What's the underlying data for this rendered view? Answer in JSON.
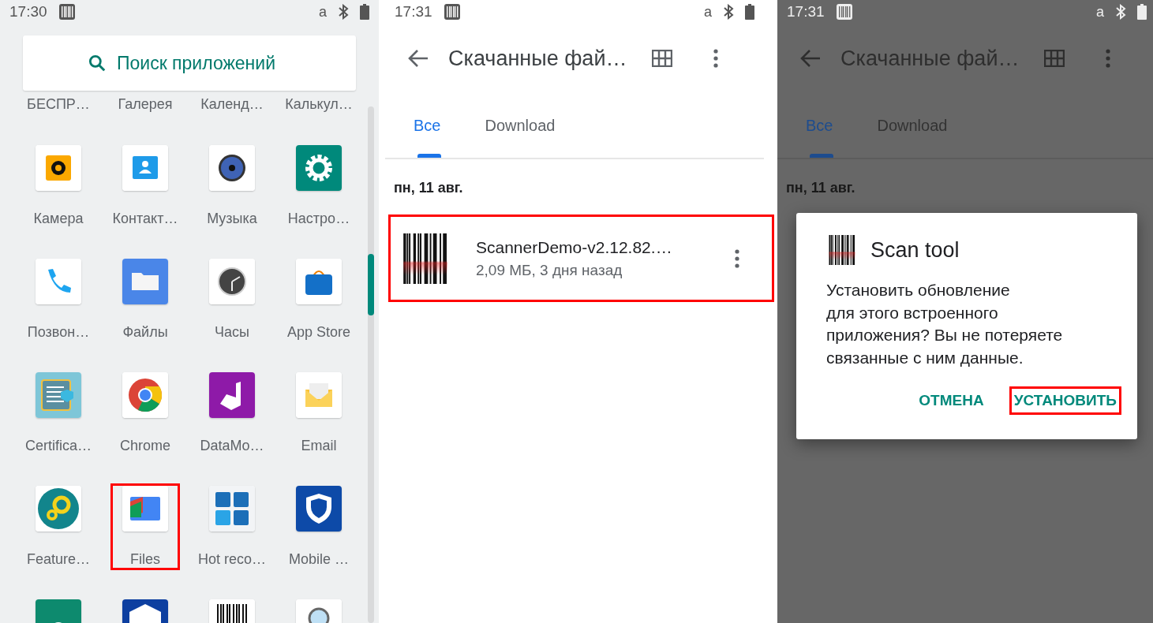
{
  "launcher": {
    "status_bar": {
      "time": "17:30",
      "keyboard": "a"
    },
    "search": {
      "placeholder": "Поиск приложений"
    },
    "app_rows": [
      {
        "apps": [
          {
            "label": "БЕСПР…"
          },
          {
            "label": "Галерея"
          },
          {
            "label": "Календ…"
          },
          {
            "label": "Калькул…"
          }
        ]
      },
      {
        "apps": [
          {
            "kind": "camera",
            "label": "Камера",
            "highlighted": false
          },
          {
            "kind": "contacts",
            "label": "Контакт…",
            "highlighted": false
          },
          {
            "kind": "speaker",
            "label": "Музыка",
            "highlighted": false
          },
          {
            "kind": "gear",
            "label": "Настро…",
            "highlighted": false
          }
        ]
      },
      {
        "apps": [
          {
            "kind": "phone",
            "label": "Позвон…",
            "highlighted": false
          },
          {
            "kind": "folder",
            "label": "Файлы",
            "highlighted": false
          },
          {
            "kind": "clock",
            "label": "Часы",
            "highlighted": false
          },
          {
            "kind": "bag",
            "label": "App Store",
            "highlighted": false
          }
        ]
      },
      {
        "apps": [
          {
            "kind": "certificate",
            "label": "Certifica…",
            "highlighted": false
          },
          {
            "kind": "chrome",
            "label": "Chrome",
            "highlighted": false
          },
          {
            "kind": "purple",
            "label": "DataMo…",
            "highlighted": false
          },
          {
            "kind": "envelope",
            "label": "Email",
            "highlighted": false
          }
        ]
      },
      {
        "apps": [
          {
            "kind": "gears",
            "label": "Feature…",
            "highlighted": false
          },
          {
            "kind": "files",
            "label": "Files",
            "highlighted": true
          },
          {
            "kind": "tiles",
            "label": "Hot reco…",
            "highlighted": false
          },
          {
            "kind": "shield",
            "label": "Mobile …",
            "highlighted": false
          }
        ]
      },
      {
        "apps": [
          {
            "kind": "android"
          },
          {
            "kind": "badge"
          },
          {
            "kind": "barcode"
          },
          {
            "kind": "magnifier"
          }
        ]
      }
    ]
  },
  "files": {
    "status_bar": {
      "time": "17:31",
      "keyboard": "a"
    },
    "toolbar": {
      "title": "Скачанные фай…"
    },
    "tabs": [
      {
        "label": "Все",
        "selected": true
      },
      {
        "label": "Download",
        "selected": false
      }
    ],
    "date_header": "пн, 11 авг.",
    "items": [
      {
        "name": "ScannerDemo-v2.12.82.…",
        "details": "2,09 МБ, 3 дня назад",
        "highlighted": true
      }
    ]
  },
  "install": {
    "status_bar": {
      "time": "17:31",
      "keyboard": "a"
    },
    "toolbar": {
      "title": "Скачанные фай…"
    },
    "tabs": [
      {
        "label": "Все",
        "selected": true
      },
      {
        "label": "Download",
        "selected": false
      }
    ],
    "date_header": "пн, 11 авг.",
    "dialog": {
      "app_name": "Scan tool",
      "message": "Установить обновление\nдля этого встроенного\nприложения? Вы не потеряете\nсвязанные с ним данные.",
      "buttons": [
        {
          "label": "ОТМЕНА",
          "highlighted": false
        },
        {
          "label": "УСТАНОВИТЬ",
          "highlighted": true
        }
      ]
    }
  }
}
